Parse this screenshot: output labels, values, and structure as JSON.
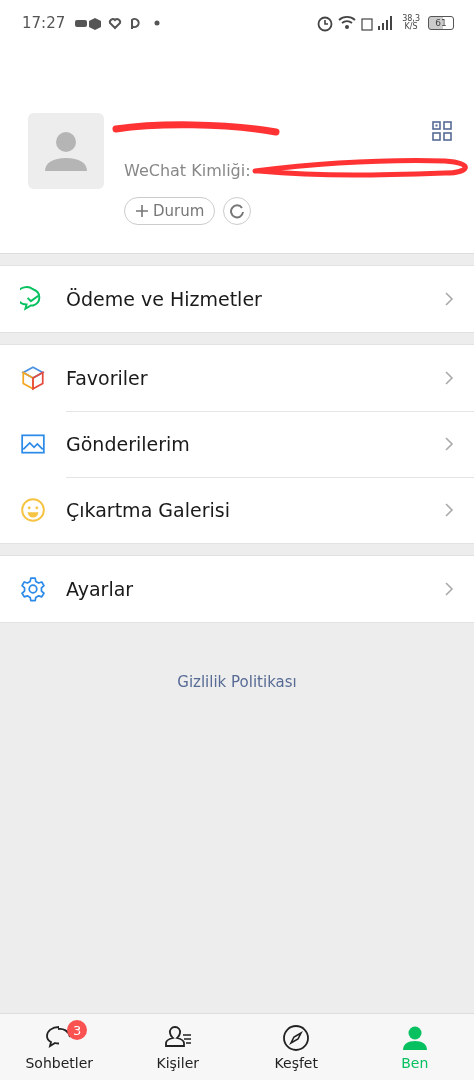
{
  "status_bar": {
    "time": "17:27",
    "network_speed": "38,3",
    "speed_unit": "K/S",
    "battery": "61"
  },
  "profile": {
    "id_label": "WeChat Kimliği:",
    "status_button": "Durum"
  },
  "menu_groups": [
    {
      "items": [
        {
          "label": "Ödeme ve Hizmetler",
          "kind": "pay"
        }
      ]
    },
    {
      "items": [
        {
          "label": "Favoriler",
          "kind": "cube"
        },
        {
          "label": "Gönderilerim",
          "kind": "image"
        },
        {
          "label": "Çıkartma Galerisi",
          "kind": "smile"
        }
      ]
    },
    {
      "items": [
        {
          "label": "Ayarlar",
          "kind": "gear"
        }
      ]
    }
  ],
  "privacy_link": "Gizlilik Politikası",
  "tabs": [
    {
      "label": "Sohbetler",
      "kind": "chat",
      "badge": "3",
      "selected": false
    },
    {
      "label": "Kişiler",
      "kind": "contacts",
      "selected": false
    },
    {
      "label": "Keşfet",
      "kind": "compass",
      "selected": false
    },
    {
      "label": "Ben",
      "kind": "me",
      "selected": true
    }
  ]
}
